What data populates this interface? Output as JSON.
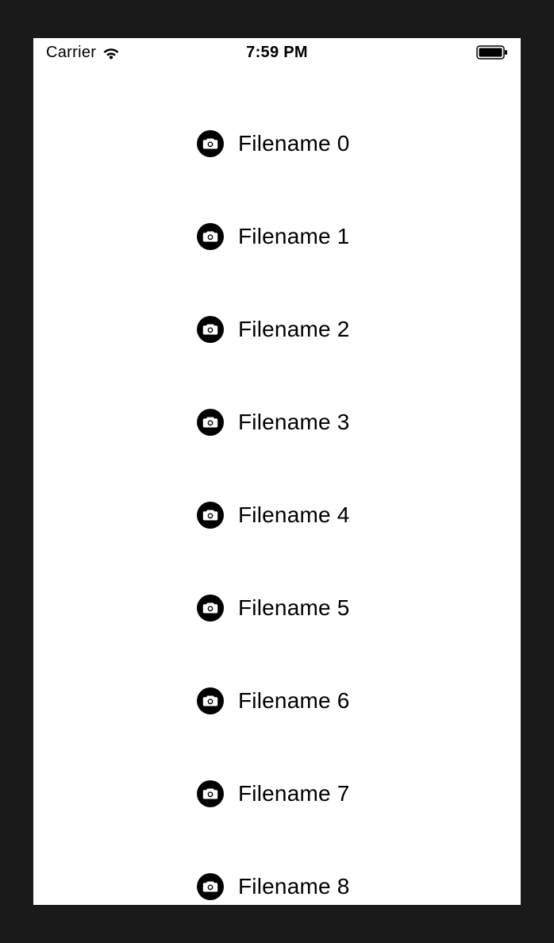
{
  "status_bar": {
    "carrier": "Carrier",
    "time": "7:59 PM"
  },
  "list": {
    "items": [
      {
        "label": "Filename 0"
      },
      {
        "label": "Filename 1"
      },
      {
        "label": "Filename 2"
      },
      {
        "label": "Filename 3"
      },
      {
        "label": "Filename 4"
      },
      {
        "label": "Filename 5"
      },
      {
        "label": "Filename 6"
      },
      {
        "label": "Filename 7"
      },
      {
        "label": "Filename 8"
      }
    ]
  }
}
